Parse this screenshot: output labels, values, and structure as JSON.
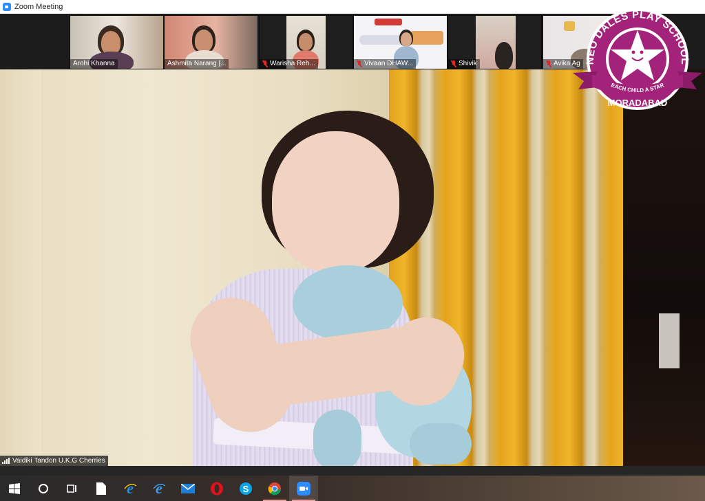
{
  "window": {
    "title": "Zoom Meeting",
    "icon": "zoom-app-icon"
  },
  "participants": [
    {
      "name": "Arohi Khanna",
      "muted": false
    },
    {
      "name": "Ashmita Narang |...",
      "muted": false
    },
    {
      "name": "Warisha Reh...",
      "muted": true
    },
    {
      "name": "Vivaan DHAW...",
      "muted": true
    },
    {
      "name": "Shivik",
      "muted": true
    },
    {
      "name": "Avika Ag",
      "muted": true
    }
  ],
  "active_speaker": {
    "name": "Vaidiki Tandon U.K.G Cherries"
  },
  "badge": {
    "top_text": "NEO DALES PLAY SCHOOL",
    "ribbon_text": "EACH CHILD A STAR",
    "bottom_text": "MORADABAD",
    "color": "#a3237a"
  },
  "taskbar": {
    "items": [
      {
        "icon": "windows-start-icon"
      },
      {
        "icon": "cortana-search-icon"
      },
      {
        "icon": "task-view-icon"
      },
      {
        "icon": "file-icon"
      },
      {
        "icon": "internet-explorer-icon"
      },
      {
        "icon": "internet-explorer-icon"
      },
      {
        "icon": "mail-icon"
      },
      {
        "icon": "opera-icon"
      },
      {
        "icon": "skype-icon"
      },
      {
        "icon": "chrome-icon"
      },
      {
        "icon": "zoom-icon"
      }
    ]
  }
}
